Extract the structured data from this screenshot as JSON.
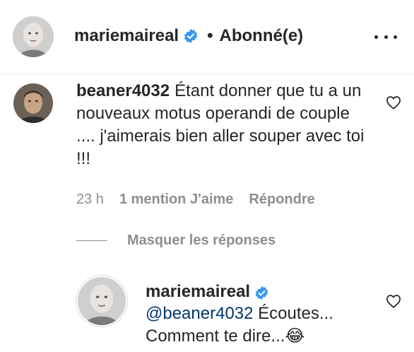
{
  "header": {
    "username": "mariemaireal",
    "separator": "•",
    "follow_status": "Abonné(e)"
  },
  "comment": {
    "author": "beaner4032",
    "text": "Étant donner que tu a un nouveaux motus operandi de couple .... j'aimerais bien aller souper avec toi !!!",
    "time": "23 h",
    "likes": "1 mention J'aime",
    "reply_label": "Répondre"
  },
  "hide_replies_label": "Masquer les réponses",
  "reply": {
    "author": "mariemaireal",
    "mention": "@beaner4032",
    "text": " Écoutes... Comment te dire...",
    "emoji": "😂"
  },
  "colors": {
    "verified": "#3897f0",
    "secondary_text": "#8e8e8e",
    "primary_text": "#262626",
    "mention": "#00376b"
  },
  "icons": [
    "verified-badge-icon",
    "more-options-icon",
    "heart-icon"
  ]
}
